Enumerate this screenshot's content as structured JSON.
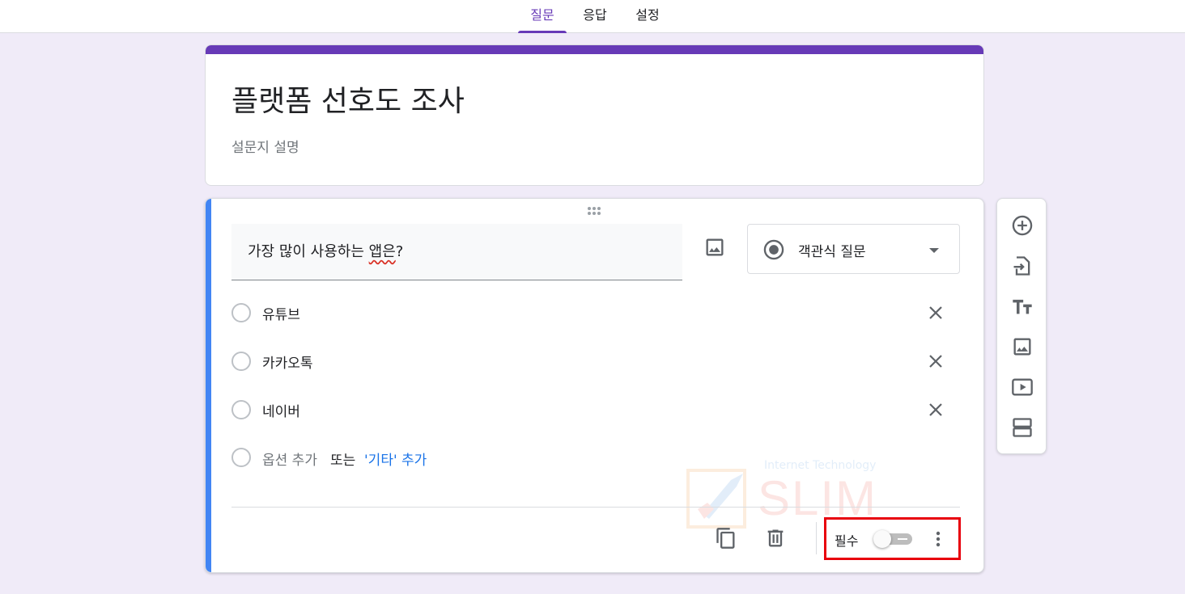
{
  "tabs": [
    {
      "label": "질문",
      "active": true
    },
    {
      "label": "응답",
      "active": false
    },
    {
      "label": "설정",
      "active": false
    }
  ],
  "form": {
    "title": "플랫폼 선호도 조사",
    "description_placeholder": "설문지 설명"
  },
  "question": {
    "text_before": "가장 많이 사용하는 ",
    "text_spell": "앱은",
    "text_after": "?",
    "type_label": "객관식 질문",
    "options": [
      {
        "label": "유튜브"
      },
      {
        "label": "카카오톡"
      },
      {
        "label": "네이버"
      }
    ],
    "add_option": "옵션 추가",
    "or_text": "또는",
    "add_other": "'기타' 추가",
    "required_label": "필수",
    "required_on": false
  },
  "watermark": {
    "small": "Internet Technology",
    "big": "SLIM"
  },
  "side_toolbar": {
    "icons": [
      "add-question-icon",
      "import-questions-icon",
      "add-title-icon",
      "add-image-icon",
      "add-video-icon",
      "add-section-icon"
    ]
  },
  "colors": {
    "accent": "#673ab7",
    "question_bar": "#4285f4",
    "background": "#f0ebf8",
    "link": "#1a73e8",
    "highlight_box": "#e8000d"
  }
}
